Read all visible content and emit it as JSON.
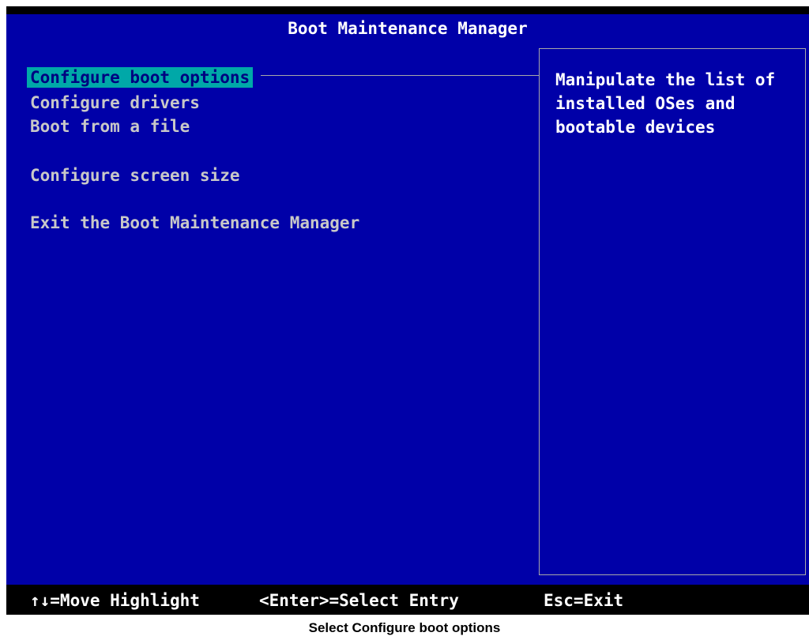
{
  "colors": {
    "background_blue": "#0000a8",
    "highlight_cyan": "#00a8a8",
    "frame_gray": "#a8a8a8",
    "footer_black": "#000000"
  },
  "header": {
    "title": "Boot Maintenance Manager"
  },
  "menu": {
    "selected_index": 0,
    "items": [
      {
        "label": "Configure boot options"
      },
      {
        "label": "Configure drivers"
      },
      {
        "label": "Boot from a file"
      },
      {
        "label": "Configure screen size"
      },
      {
        "label": "Exit the Boot Maintenance Manager"
      }
    ]
  },
  "help": {
    "lines": [
      "Manipulate the list of",
      "installed OSes and",
      "bootable devices"
    ]
  },
  "footer": {
    "move_hint": "↑↓=Move Highlight",
    "select_hint": "<Enter>=Select Entry",
    "exit_hint": "Esc=Exit"
  },
  "caption": "Select Configure boot options"
}
